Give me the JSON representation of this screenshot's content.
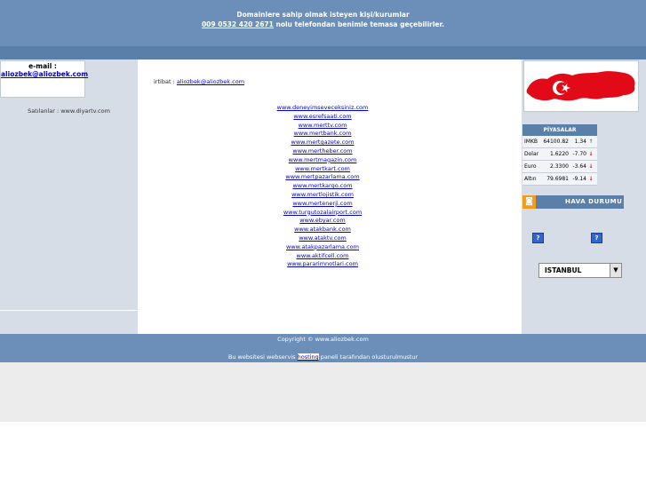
{
  "header": {
    "line1": "Domainlere sahip olmak isteyen kişi/kurumlar",
    "phone": "009 0532 420 2671",
    "line2_rest": " nolu telefondan benimle temasa geçebilirler."
  },
  "left": {
    "email_label": "e-mail :",
    "email_value": "aliozbek@aliozbek.com",
    "satiliklar": "Satılanlar : www.diyartv.com"
  },
  "main": {
    "iletisim_label": "irtibat : ",
    "iletisim_email": "aliozbek@aliozbek.com",
    "links": [
      "www.deneyimseveceksiniz.com",
      "www.esrefsaati.com",
      "www.merttv.com",
      "www.mertbank.com",
      "www.mertgazete.com",
      "www.mertheber.com",
      "www.mertmagazin.com",
      "www.mertkart.com",
      "www.mertpazarlama.com",
      "www.mertkargo.com",
      "www.mertlojistik.com",
      "www.mertenerji.com",
      "www.turgutozalairport.com",
      "www.ebyar.com",
      "www.atakbank.com",
      "www.ataktv.com",
      "www.atakpazarlama.com",
      "www.aktifcell.com",
      "www.pararimnotlari.com"
    ]
  },
  "piyasalar": {
    "title": "PİYASALAR",
    "rows": [
      {
        "name": "IMKB",
        "value": "64100.82",
        "change": "1.34",
        "dir": "up",
        "arrow": "↑"
      },
      {
        "name": "Dolar",
        "value": "1.6220",
        "change": "-7.70",
        "dir": "down",
        "arrow": "↓"
      },
      {
        "name": "Euro",
        "value": "2.3300",
        "change": "-3.64",
        "dir": "down",
        "arrow": "↓"
      },
      {
        "name": "Altın",
        "value": "79.6981",
        "change": "-9.14",
        "dir": "down",
        "arrow": "↓"
      }
    ]
  },
  "hava": {
    "title": "HAVA DURUMU",
    "icon": "rss-icon",
    "q1": "?",
    "q2": "?",
    "city": "ISTANBUL",
    "dropdown_arrow": "▼"
  },
  "footer": {
    "copyright": "Copyright © www.aliozbek.com",
    "hosting_pre": "Bu websitesi webservis ",
    "hosting_link": "hosting",
    "hosting_post": " paneli tarafından olusturulmustur"
  },
  "colors": {
    "header_bg": "#6b8fb8",
    "side_bg": "#d6dde6",
    "link": "#0000cc",
    "flag_red": "#e30a17"
  }
}
